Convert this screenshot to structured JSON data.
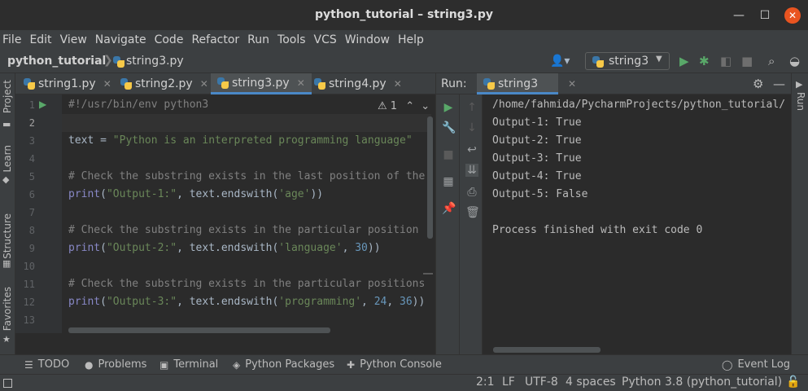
{
  "window": {
    "title": "python_tutorial – string3.py"
  },
  "menu": [
    "File",
    "Edit",
    "View",
    "Navigate",
    "Code",
    "Refactor",
    "Run",
    "Tools",
    "VCS",
    "Window",
    "Help"
  ],
  "breadcrumb": {
    "project": "python_tutorial",
    "file": "string3.py"
  },
  "run_config": {
    "name": "string3"
  },
  "editor": {
    "tabs": [
      {
        "label": "string1.py",
        "active": false
      },
      {
        "label": "string2.py",
        "active": false
      },
      {
        "label": "string3.py",
        "active": true
      },
      {
        "label": "string4.py",
        "active": false
      }
    ],
    "warnings": "1",
    "line_numbers": [
      "1",
      "2",
      "3",
      "4",
      "5",
      "6",
      "7",
      "8",
      "9",
      "10",
      "11",
      "12",
      "13"
    ],
    "code": {
      "l1": "#!/usr/bin/env python3",
      "l3a": "text = ",
      "l3b": "\"Python is an interpreted programming language\"",
      "l5": "# Check the substring exists in the last position of the",
      "l6a": "print",
      "l6b": "(",
      "l6c": "\"Output-1:\"",
      "l6d": ", text.endswith(",
      "l6e": "'age'",
      "l6f": "))",
      "l8": "# Check the substring exists in the particular position",
      "l9a": "print",
      "l9b": "(",
      "l9c": "\"Output-2:\"",
      "l9d": ", text.endswith(",
      "l9e": "'language'",
      "l9f": ", ",
      "l9g": "30",
      "l9h": "))",
      "l11": "# Check the substring exists in the particular positions",
      "l12a": "print",
      "l12b": "(",
      "l12c": "\"Output-3:\"",
      "l12d": ", text.endswith(",
      "l12e": "'programming'",
      "l12f": ", ",
      "l12g": "24",
      "l12h": ", ",
      "l12i": "36",
      "l12j": "))"
    }
  },
  "run_panel": {
    "label": "Run:",
    "tab": "string3",
    "side_label": "Run",
    "output": [
      "/home/fahmida/PycharmProjects/python_tutorial/",
      "Output-1: True",
      "Output-2: True",
      "Output-3: True",
      "Output-4: True",
      "Output-5: False",
      "",
      "Process finished with exit code 0"
    ]
  },
  "left_tools": [
    "Project",
    "Learn",
    "Structure",
    "Favorites"
  ],
  "bottom_tools": [
    "TODO",
    "Problems",
    "Terminal",
    "Python Packages",
    "Python Console",
    "Event Log"
  ],
  "status": {
    "position": "2:1",
    "line_sep": "LF",
    "encoding": "UTF-8",
    "indent": "4 spaces",
    "interpreter": "Python 3.8 (python_tutorial)"
  }
}
